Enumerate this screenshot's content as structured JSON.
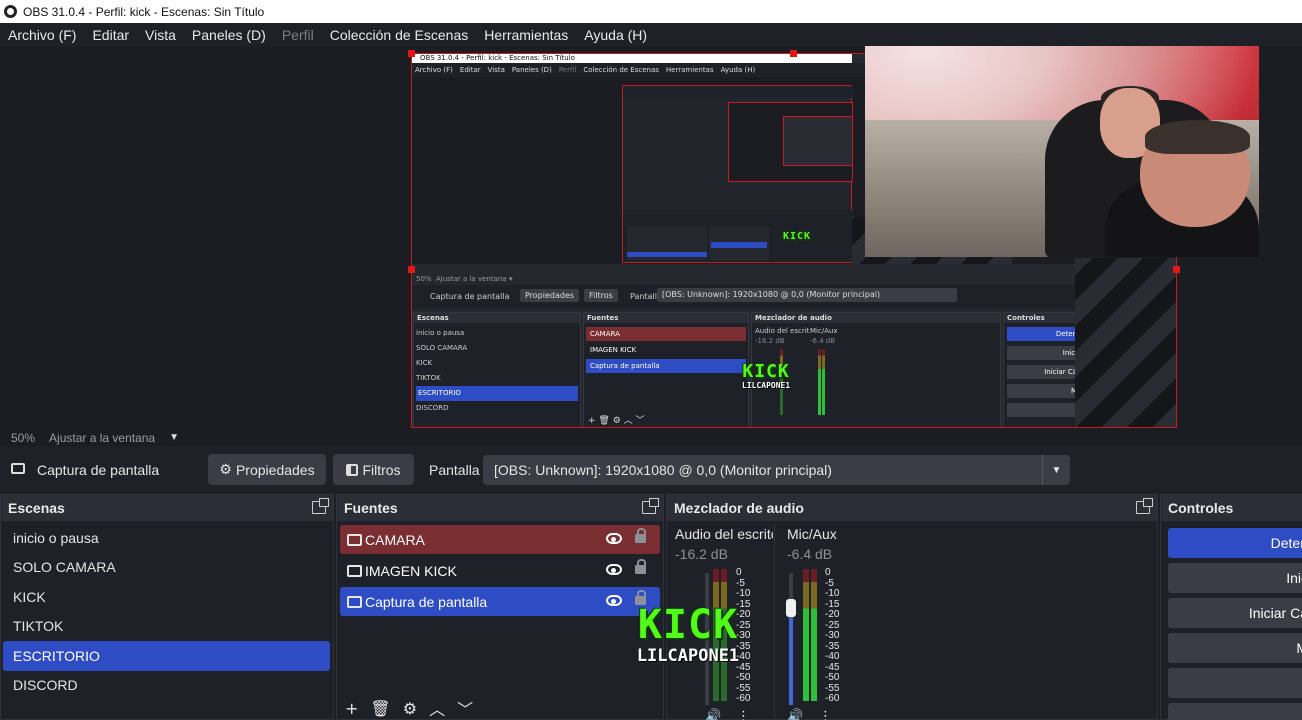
{
  "window": {
    "title": "OBS 31.0.4 - Perfil: kick - Escenas: Sin Título"
  },
  "menu": [
    {
      "label": "Archivo (F)",
      "disabled": false
    },
    {
      "label": "Editar",
      "disabled": false
    },
    {
      "label": "Vista",
      "disabled": false
    },
    {
      "label": "Paneles (D)",
      "disabled": false
    },
    {
      "label": "Perfil",
      "disabled": true
    },
    {
      "label": "Colección de Escenas",
      "disabled": false
    },
    {
      "label": "Herramientas",
      "disabled": false
    },
    {
      "label": "Ayuda (H)",
      "disabled": false
    }
  ],
  "nested": {
    "title": "OBS 31.0.4 - Perfil: kick - Escenas: Sin Título",
    "menu": [
      "Archivo (F)",
      "Editar",
      "Vista",
      "Paneles (D)",
      "Perfil",
      "Colección de Escenas",
      "Herramientas",
      "Ayuda (H)"
    ],
    "zoom": "50%",
    "fit": "Ajustar a la ventana",
    "source_name": "Captura de pantalla",
    "properties": "Propiedades",
    "filters": "Filtros",
    "display_label": "Pantalla",
    "display_value": "[OBS: Unknown]: 1920x1080 @ 0,0 (Monitor principal)",
    "scenes_title": "Escenas",
    "sources_title": "Fuentes",
    "mixer_title": "Mezclador de audio",
    "controls_title": "Controles",
    "ch1_name": "Audio del escrit",
    "ch1_db": "-16.2 dB",
    "ch2_name": "Mic/Aux",
    "ch2_db": "-6.4 dB",
    "controls": [
      "Deten",
      "Inici",
      "Iniciar Cá",
      "M"
    ]
  },
  "zoom": {
    "level": "50%",
    "fit_label": "Ajustar a la ventana"
  },
  "source_toolbar": {
    "source_name": "Captura de pantalla",
    "properties_label": "Propiedades",
    "filters_label": "Filtros",
    "display_label": "Pantalla",
    "display_value": "[OBS: Unknown]: 1920x1080 @ 0,0 (Monitor principal)"
  },
  "scenes": {
    "title": "Escenas",
    "items": [
      {
        "label": "inicio o pausa",
        "active": false
      },
      {
        "label": "SOLO CAMARA",
        "active": false
      },
      {
        "label": "KICK",
        "active": false
      },
      {
        "label": "TIKTOK",
        "active": false
      },
      {
        "label": "ESCRITORIO",
        "active": true
      },
      {
        "label": "DISCORD",
        "active": false
      }
    ]
  },
  "sources": {
    "title": "Fuentes",
    "items": [
      {
        "label": "CAMARA",
        "icon": "camera-icon",
        "bg": "#7a2e32"
      },
      {
        "label": "IMAGEN KICK",
        "icon": "image-icon",
        "bg": "transparent"
      },
      {
        "label": "Captura de pantalla",
        "icon": "monitor-icon",
        "bg": "#2e4cc3"
      }
    ]
  },
  "mixer": {
    "title": "Mezclador de audio",
    "channels": [
      {
        "name": "Audio del escrito",
        "db": "-16.2 dB"
      },
      {
        "name": "Mic/Aux",
        "db": "-6.4 dB"
      }
    ],
    "ticks": [
      "0",
      "-5",
      "-10",
      "-15",
      "-20",
      "-25",
      "-30",
      "-35",
      "-40",
      "-45",
      "-50",
      "-55",
      "-60"
    ]
  },
  "overlay": {
    "kick": "KICK",
    "user": "LILCAPONE1"
  },
  "controls": {
    "title": "Controles",
    "buttons": [
      {
        "label": "Deten",
        "primary": true
      },
      {
        "label": "Inic",
        "primary": false
      },
      {
        "label": "Iniciar Cá",
        "primary": false
      },
      {
        "label": "M",
        "primary": false
      },
      {
        "label": "",
        "primary": false
      },
      {
        "label": "",
        "primary": false
      }
    ]
  },
  "colors": {
    "accent": "#2e4cc3",
    "camera_row": "#7a2e32",
    "kick_green": "#53fc18",
    "selection_red": "#e01818"
  }
}
